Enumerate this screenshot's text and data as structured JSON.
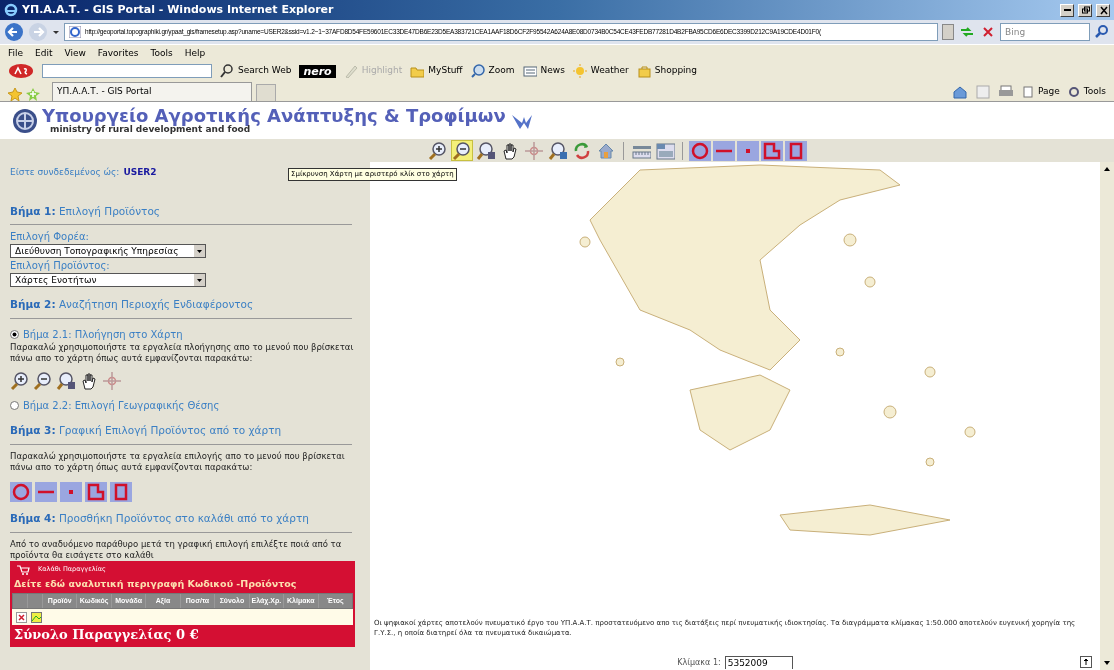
{
  "window": {
    "title": "ΥΠ.Α.Α.Τ. - GIS Portal - Windows Internet Explorer"
  },
  "address_bar": {
    "url": "http://geoportal.topographiki.gr/ypaat_gis/framesetup.asp?uname=USER2&ssid=v1.2~1~37AFD8D54FE59601EC33DE47DB6E23D5EA383721CEA1AAF18D6CF2F95542A624A8E08D0734B0C54CE43FEDB77281D4B2FBA95CD6E6DEC3399D212C9A19CDE4D01F0(",
    "search_placeholder": "Bing"
  },
  "menu": [
    "File",
    "Edit",
    "View",
    "Favorites",
    "Tools",
    "Help"
  ],
  "links_toolbar": [
    {
      "label": "Search Web",
      "kind": "search",
      "disabled": false
    },
    {
      "label": "nero",
      "kind": "logo",
      "disabled": false
    },
    {
      "label": "Highlight",
      "kind": "pen",
      "disabled": true
    },
    {
      "label": "MyStuff",
      "kind": "folder",
      "disabled": false
    },
    {
      "label": "Zoom",
      "kind": "zoom",
      "disabled": false
    },
    {
      "label": "News",
      "kind": "news",
      "disabled": false
    },
    {
      "label": "Weather",
      "kind": "sun",
      "disabled": false
    },
    {
      "label": "Shopping",
      "kind": "bag",
      "disabled": false
    }
  ],
  "tab": {
    "label": "ΥΠ.Α.Α.Τ. - GIS Portal"
  },
  "command_bar": [
    "Page",
    "Tools"
  ],
  "header": {
    "title": "Υπουργείο Αγροτικής Ανάπτυξης & Τροφίμων",
    "subtitle": "ministry of rural development and food"
  },
  "map_tools": [
    {
      "kind": "zoom-in",
      "selected": false
    },
    {
      "kind": "zoom-out",
      "selected": true
    },
    {
      "kind": "zoom-box",
      "selected": false
    },
    {
      "kind": "pan",
      "selected": false
    },
    {
      "kind": "crosshair",
      "selected": false
    },
    {
      "kind": "zoom-layer",
      "selected": false
    },
    {
      "kind": "refresh",
      "selected": false
    },
    {
      "kind": "home",
      "selected": false
    },
    {
      "kind": "ruler",
      "selected": false
    },
    {
      "kind": "panel",
      "selected": false
    }
  ],
  "select_tools": [
    {
      "kind": "circle",
      "selected": false
    },
    {
      "kind": "line",
      "selected": false
    },
    {
      "kind": "point",
      "selected": false
    },
    {
      "kind": "polygon",
      "selected": false
    },
    {
      "kind": "rectangle",
      "selected": false
    }
  ],
  "tooltip": "Σμίκρυνση Χάρτη με αριστερό κλίκ στο χάρτη",
  "sidebar": {
    "logged_in_label": "Είστε συνδεδεμένος ώς:",
    "user": "USER2",
    "step1": {
      "heading": "**Βήμα 1:** Επιλογή Προϊόντος",
      "fields": [
        {
          "label": "Επιλογή Φορέα:",
          "value": "Διεύθυνση Τοπογραφικής Υπηρεσίας"
        },
        {
          "label": "Επιλογή Προϊόντος:",
          "value": "Χάρτες Ενοτήτων"
        }
      ]
    },
    "step2": {
      "heading": "**Βήμα 2:** Αναζήτηση Περιοχής Ενδιαφέροντος",
      "options": [
        {
          "label": "Βήμα 2.1: Πλοήγηση στο Χάρτη",
          "selected": true
        },
        {
          "label": "Βήμα 2.2: Επιλογή Γεωγραφικής Θέσης",
          "selected": false
        }
      ],
      "text": "Παρακαλώ χρησιμοποιήστε τα εργαλεία πλοήγησης απο το μενού που βρίσκεται πάνω απο το χάρτη όπως αυτά εμφανίζονται παρακάτω:"
    },
    "step3": {
      "heading": "**Βήμα 3:** Γραφική Επιλογή Προϊόντος από το χάρτη",
      "text": "Παρακαλώ χρησιμοποιήστε τα εργαλεία επιλογής απο το μενού που βρίσκεται πάνω απο το χάρτη όπως αυτά εμφανίζονται παρακάτω:"
    },
    "step4": {
      "heading": "**Βήμα 4:** Προσθήκη Προϊόντος στο καλάθι από το χάρτη",
      "text": "Από το αναδυόμενο παράθυρο μετά τη γραφική επιλογή επιλέξτε ποιά από τα προϊόντα θα εισάγετε στο καλάθι"
    },
    "cart": {
      "title": "Καλάθι Παραγγελίας",
      "link": "Δείτε εδώ αναλυτική περιγραφή Κωδικού -Προϊόντος",
      "columns": [
        "Προϊόν",
        "Κωδικός",
        "Μονάδα",
        "Αξία",
        "Ποσ/τα",
        "Σύνολο",
        "Ελάχ.Χρ.",
        "Κλίμακα",
        "Έτος"
      ],
      "total": "Σύνολο Παραγγελίας 0 €"
    }
  },
  "map": {
    "copyright": "Οι ψηφιακοί χάρτες αποτελούν πνευματικό έργο του ΥΠ.Α.Α.Τ. προστατευόμενο απο τις διατάξεις περί πνευματικής ιδιοκτησίας. Τα διαγράμματα κλίμακας 1:50.000 αποτελούν ευγενική χορηγία της Γ.Υ.Σ., η οποία διατηρεί όλα τα πνευματικά δικαιώματα.",
    "scale_label": "Κλίμακα 1:",
    "scale_value": "5352009"
  }
}
